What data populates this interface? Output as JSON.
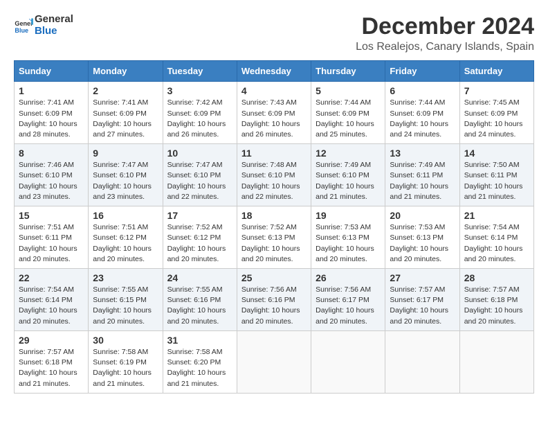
{
  "logo": {
    "general": "General",
    "blue": "Blue"
  },
  "title": "December 2024",
  "subtitle": "Los Realejos, Canary Islands, Spain",
  "weekdays": [
    "Sunday",
    "Monday",
    "Tuesday",
    "Wednesday",
    "Thursday",
    "Friday",
    "Saturday"
  ],
  "weeks": [
    [
      {
        "day": "1",
        "sunrise": "Sunrise: 7:41 AM",
        "sunset": "Sunset: 6:09 PM",
        "daylight": "Daylight: 10 hours and 28 minutes."
      },
      {
        "day": "2",
        "sunrise": "Sunrise: 7:41 AM",
        "sunset": "Sunset: 6:09 PM",
        "daylight": "Daylight: 10 hours and 27 minutes."
      },
      {
        "day": "3",
        "sunrise": "Sunrise: 7:42 AM",
        "sunset": "Sunset: 6:09 PM",
        "daylight": "Daylight: 10 hours and 26 minutes."
      },
      {
        "day": "4",
        "sunrise": "Sunrise: 7:43 AM",
        "sunset": "Sunset: 6:09 PM",
        "daylight": "Daylight: 10 hours and 26 minutes."
      },
      {
        "day": "5",
        "sunrise": "Sunrise: 7:44 AM",
        "sunset": "Sunset: 6:09 PM",
        "daylight": "Daylight: 10 hours and 25 minutes."
      },
      {
        "day": "6",
        "sunrise": "Sunrise: 7:44 AM",
        "sunset": "Sunset: 6:09 PM",
        "daylight": "Daylight: 10 hours and 24 minutes."
      },
      {
        "day": "7",
        "sunrise": "Sunrise: 7:45 AM",
        "sunset": "Sunset: 6:09 PM",
        "daylight": "Daylight: 10 hours and 24 minutes."
      }
    ],
    [
      {
        "day": "8",
        "sunrise": "Sunrise: 7:46 AM",
        "sunset": "Sunset: 6:10 PM",
        "daylight": "Daylight: 10 hours and 23 minutes."
      },
      {
        "day": "9",
        "sunrise": "Sunrise: 7:47 AM",
        "sunset": "Sunset: 6:10 PM",
        "daylight": "Daylight: 10 hours and 23 minutes."
      },
      {
        "day": "10",
        "sunrise": "Sunrise: 7:47 AM",
        "sunset": "Sunset: 6:10 PM",
        "daylight": "Daylight: 10 hours and 22 minutes."
      },
      {
        "day": "11",
        "sunrise": "Sunrise: 7:48 AM",
        "sunset": "Sunset: 6:10 PM",
        "daylight": "Daylight: 10 hours and 22 minutes."
      },
      {
        "day": "12",
        "sunrise": "Sunrise: 7:49 AM",
        "sunset": "Sunset: 6:10 PM",
        "daylight": "Daylight: 10 hours and 21 minutes."
      },
      {
        "day": "13",
        "sunrise": "Sunrise: 7:49 AM",
        "sunset": "Sunset: 6:11 PM",
        "daylight": "Daylight: 10 hours and 21 minutes."
      },
      {
        "day": "14",
        "sunrise": "Sunrise: 7:50 AM",
        "sunset": "Sunset: 6:11 PM",
        "daylight": "Daylight: 10 hours and 21 minutes."
      }
    ],
    [
      {
        "day": "15",
        "sunrise": "Sunrise: 7:51 AM",
        "sunset": "Sunset: 6:11 PM",
        "daylight": "Daylight: 10 hours and 20 minutes."
      },
      {
        "day": "16",
        "sunrise": "Sunrise: 7:51 AM",
        "sunset": "Sunset: 6:12 PM",
        "daylight": "Daylight: 10 hours and 20 minutes."
      },
      {
        "day": "17",
        "sunrise": "Sunrise: 7:52 AM",
        "sunset": "Sunset: 6:12 PM",
        "daylight": "Daylight: 10 hours and 20 minutes."
      },
      {
        "day": "18",
        "sunrise": "Sunrise: 7:52 AM",
        "sunset": "Sunset: 6:13 PM",
        "daylight": "Daylight: 10 hours and 20 minutes."
      },
      {
        "day": "19",
        "sunrise": "Sunrise: 7:53 AM",
        "sunset": "Sunset: 6:13 PM",
        "daylight": "Daylight: 10 hours and 20 minutes."
      },
      {
        "day": "20",
        "sunrise": "Sunrise: 7:53 AM",
        "sunset": "Sunset: 6:13 PM",
        "daylight": "Daylight: 10 hours and 20 minutes."
      },
      {
        "day": "21",
        "sunrise": "Sunrise: 7:54 AM",
        "sunset": "Sunset: 6:14 PM",
        "daylight": "Daylight: 10 hours and 20 minutes."
      }
    ],
    [
      {
        "day": "22",
        "sunrise": "Sunrise: 7:54 AM",
        "sunset": "Sunset: 6:14 PM",
        "daylight": "Daylight: 10 hours and 20 minutes."
      },
      {
        "day": "23",
        "sunrise": "Sunrise: 7:55 AM",
        "sunset": "Sunset: 6:15 PM",
        "daylight": "Daylight: 10 hours and 20 minutes."
      },
      {
        "day": "24",
        "sunrise": "Sunrise: 7:55 AM",
        "sunset": "Sunset: 6:16 PM",
        "daylight": "Daylight: 10 hours and 20 minutes."
      },
      {
        "day": "25",
        "sunrise": "Sunrise: 7:56 AM",
        "sunset": "Sunset: 6:16 PM",
        "daylight": "Daylight: 10 hours and 20 minutes."
      },
      {
        "day": "26",
        "sunrise": "Sunrise: 7:56 AM",
        "sunset": "Sunset: 6:17 PM",
        "daylight": "Daylight: 10 hours and 20 minutes."
      },
      {
        "day": "27",
        "sunrise": "Sunrise: 7:57 AM",
        "sunset": "Sunset: 6:17 PM",
        "daylight": "Daylight: 10 hours and 20 minutes."
      },
      {
        "day": "28",
        "sunrise": "Sunrise: 7:57 AM",
        "sunset": "Sunset: 6:18 PM",
        "daylight": "Daylight: 10 hours and 20 minutes."
      }
    ],
    [
      {
        "day": "29",
        "sunrise": "Sunrise: 7:57 AM",
        "sunset": "Sunset: 6:18 PM",
        "daylight": "Daylight: 10 hours and 21 minutes."
      },
      {
        "day": "30",
        "sunrise": "Sunrise: 7:58 AM",
        "sunset": "Sunset: 6:19 PM",
        "daylight": "Daylight: 10 hours and 21 minutes."
      },
      {
        "day": "31",
        "sunrise": "Sunrise: 7:58 AM",
        "sunset": "Sunset: 6:20 PM",
        "daylight": "Daylight: 10 hours and 21 minutes."
      },
      null,
      null,
      null,
      null
    ]
  ]
}
